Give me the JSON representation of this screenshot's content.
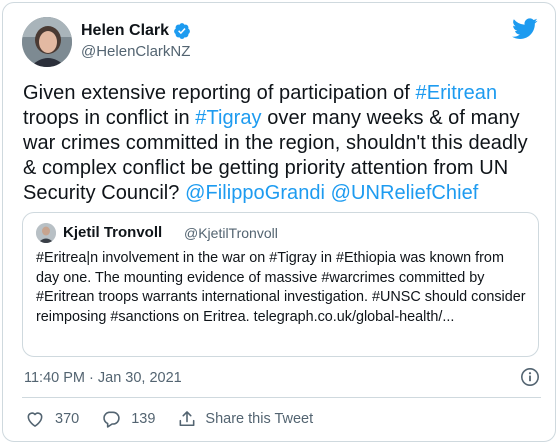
{
  "author": {
    "display_name": "Helen Clark",
    "handle": "@HelenClarkNZ",
    "verified": true
  },
  "tweet": {
    "segments": [
      {
        "text": "Given extensive reporting of participation of ",
        "type": "text"
      },
      {
        "text": "#Eritrean",
        "type": "link"
      },
      {
        "text": " troops in conflict in ",
        "type": "text"
      },
      {
        "text": "#Tigray",
        "type": "link"
      },
      {
        "text": " over many weeks & of many war crimes committed in the region, shouldn't this deadly & complex conflict be getting priority attention from UN Security Council? ",
        "type": "text"
      },
      {
        "text": "@FilippoGrandi",
        "type": "link"
      },
      {
        "text": " ",
        "type": "text"
      },
      {
        "text": "@UNReliefChief",
        "type": "link"
      }
    ]
  },
  "quoted_tweet": {
    "display_name": "Kjetil Tronvoll",
    "handle": "@KjetilTronvoll",
    "text": "#Eritrea|n involvement in the war on #Tigray in #Ethiopia was known from day one. The mounting evidence of massive #warcrimes committed by #Eritrean troops warrants international investigation. #UNSC should consider reimposing #sanctions on Eritrea.  telegraph.co.uk/global-health/..."
  },
  "meta": {
    "timestamp": "11:40 PM · Jan 30, 2021"
  },
  "actions": {
    "likes": "370",
    "replies": "139",
    "share_label": "Share this Tweet"
  },
  "colors": {
    "link": "#1d9bf0",
    "secondary_text": "#536471",
    "border": "#cfd9de",
    "brand": "#1d9bf0"
  },
  "icons": [
    "verified-badge-icon",
    "twitter-bird-icon",
    "info-icon",
    "heart-icon",
    "reply-icon",
    "share-icon"
  ]
}
